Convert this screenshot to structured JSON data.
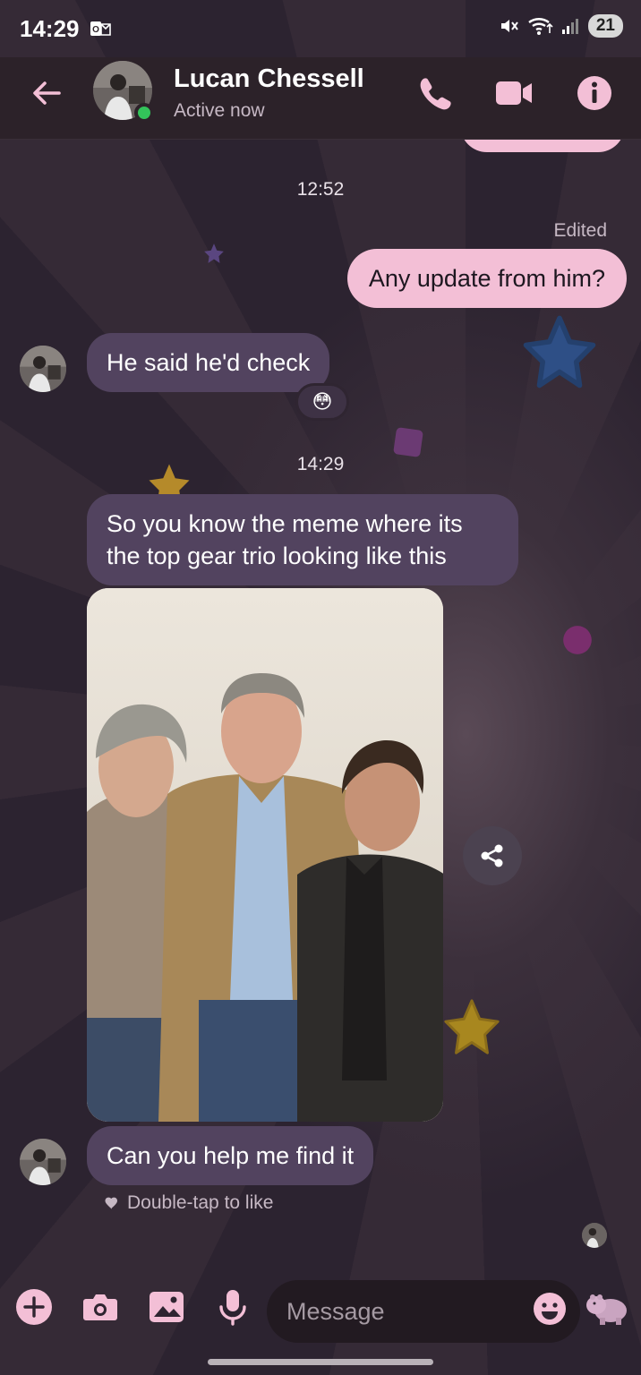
{
  "status_bar": {
    "time": "14:29",
    "battery": "21",
    "icons": [
      "outlook-icon",
      "mute-icon",
      "wifi-icon",
      "signal-icon"
    ]
  },
  "header": {
    "contact_name": "Lucan Chessell",
    "contact_status": "Active now",
    "icons": [
      "back-arrow-icon",
      "phone-icon",
      "video-icon",
      "info-icon"
    ],
    "accent_color": "#f3bfd6"
  },
  "conversation": {
    "time_1": "12:52",
    "edited_label": "Edited",
    "outgoing_1": "Any update from him?",
    "incoming_1": "He said he'd check",
    "reaction_1": "😳",
    "time_2": "14:29",
    "incoming_2": "So you know the meme where its the top gear trio looking like this",
    "incoming_3": "Can you help me find it",
    "like_hint": "Double-tap to like"
  },
  "composer": {
    "placeholder": "Message",
    "icons": [
      "plus-icon",
      "camera-icon",
      "gallery-icon",
      "mic-icon",
      "emoji-icon",
      "hippo-sticker-icon"
    ]
  },
  "colors": {
    "incoming_bubble": "#52435f",
    "outgoing_bubble": "#f3bfd6",
    "online": "#33c35a",
    "background": "#2f2531"
  }
}
